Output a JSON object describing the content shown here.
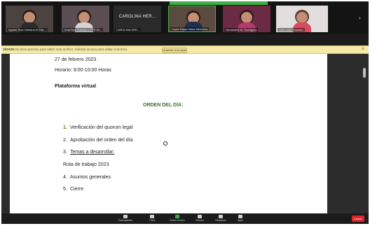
{
  "gallery": {
    "participants": [
      {
        "name": "Aguilar Ruiz Orellana M Patr..."
      },
      {
        "name": "Irma Ruiz Ramirez | PTR Eli..."
      },
      {
        "name": "CAROLINA HER..."
      },
      {
        "name": "Lopez Rojas Salas Mendoza"
      },
      {
        "name": "Hernandez M. Rodriguez"
      },
      {
        "name": "Ana Laura Guzman"
      }
    ],
    "center_tile_label": "CAROLINA HER...",
    "recording_banner": ""
  },
  "sharebar": {
    "message_prefix": "JESION",
    "message": "No tiene permiso para editar este archivo. Solicitar acceso para editar el archivo.",
    "button": "Guardar una copia",
    "close": "×"
  },
  "document": {
    "date_line": "27 de febrero 2023",
    "time_line": "Horario: 9:00-10:00 Horas",
    "platform_line": "Plataforma virtual",
    "agenda_title": "ORDEN DEL DÍA:",
    "items": [
      {
        "num": "1.",
        "text": "Verificación del quorum legal"
      },
      {
        "num": "2.",
        "text": "Aprobación del orden del día"
      },
      {
        "num": "3.",
        "text": "Temas a desarrollar:"
      }
    ],
    "subitem": "Ruta de trabajo 2023",
    "items_after": [
      {
        "num": "4.",
        "text": "Asuntos generales"
      },
      {
        "num": "5.",
        "text": "Cierre."
      }
    ]
  },
  "toolbar": {
    "buttons": [
      {
        "label": "Participantes",
        "icon": "participants-icon"
      },
      {
        "label": "Chat",
        "icon": "chat-icon"
      },
      {
        "label": "Share Screen",
        "icon": "share-screen-icon"
      },
      {
        "label": "Record",
        "icon": "record-icon"
      },
      {
        "label": "Reactions",
        "icon": "reactions-icon"
      },
      {
        "label": "Apps",
        "icon": "apps-icon"
      }
    ],
    "end_label": "Leave"
  },
  "colors": {
    "share_bar": "#f4e9a6",
    "agenda_title": "#3b6b2f",
    "end_button": "#e0252d",
    "active_speaker": "#3fae49"
  }
}
